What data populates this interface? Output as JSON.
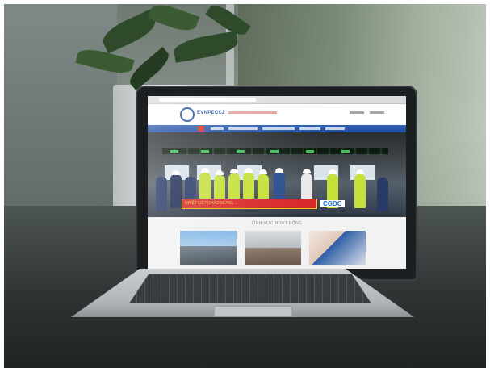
{
  "site": {
    "logo_text": "EVNPECC2",
    "banner_text": "NHIỆT LIỆT CHÀO MỪNG ...",
    "cgdc_label": "CGDC",
    "section_title": "LĨNH VỰC HOẠT ĐỘNG"
  },
  "colors": {
    "brand_blue": "#1e4fa3",
    "nav_red": "#d32f2f",
    "banner_red": "#d92b2b",
    "banner_yellow": "#f6d54a",
    "vest_yellow": "#c6e03a"
  }
}
